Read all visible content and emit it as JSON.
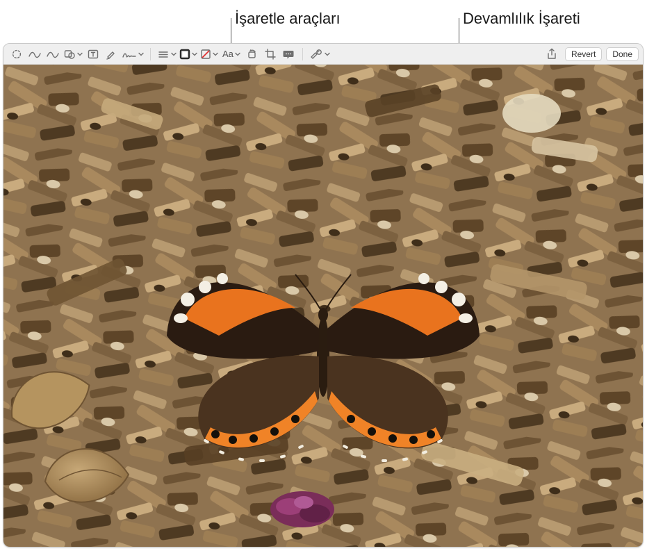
{
  "callouts": {
    "markup_tools": "İşaretle araçları",
    "continuity_markup": "Devamlılık İşareti"
  },
  "toolbar": {
    "items": [
      {
        "name": "selection-tool-icon",
        "type": "icon"
      },
      {
        "name": "sketch-tool-icon",
        "type": "icon"
      },
      {
        "name": "draw-tool-icon",
        "type": "icon"
      },
      {
        "name": "shapes-menu-icon",
        "type": "icon",
        "chevron": true
      },
      {
        "name": "text-tool-icon",
        "type": "icon"
      },
      {
        "name": "highlight-tool-icon",
        "type": "icon"
      },
      {
        "name": "sign-tool-icon",
        "type": "icon",
        "chevron": true
      },
      {
        "name": "sep"
      },
      {
        "name": "line-style-menu-icon",
        "type": "icon",
        "chevron": true
      },
      {
        "name": "border-color-menu-icon",
        "type": "icon",
        "chevron": true
      },
      {
        "name": "fill-color-menu-icon",
        "type": "icon",
        "chevron": true
      },
      {
        "name": "text-style-menu",
        "type": "text",
        "label": "Aa",
        "chevron": true
      },
      {
        "name": "rotate-tool-icon",
        "type": "icon"
      },
      {
        "name": "crop-tool-icon",
        "type": "icon"
      },
      {
        "name": "image-description-icon",
        "type": "icon"
      },
      {
        "name": "sep"
      },
      {
        "name": "continuity-markup-icon",
        "type": "icon",
        "chevron": true
      }
    ],
    "text_style_label": "Aa",
    "share_label": "",
    "revert_label": "Revert",
    "done_label": "Done"
  },
  "colors": {
    "toolbar_bg": "#efefef",
    "icon": "#6f6f6f",
    "accent_red": "#e03030"
  },
  "image": {
    "description": "Fotoğraf: tahta parçaları (talaş/yonga) zemini üzerinde kanatları açık, turuncu-siyah-beyaz desenli bir kelebek; sol altta kuru yapraklar, alt orta kısımda mor-pembe kurumuş çiçek.",
    "dominant_colors": [
      "#a78862",
      "#7a5c3a",
      "#4a3420",
      "#e06a1a",
      "#1a140e",
      "#efe7d6"
    ]
  }
}
